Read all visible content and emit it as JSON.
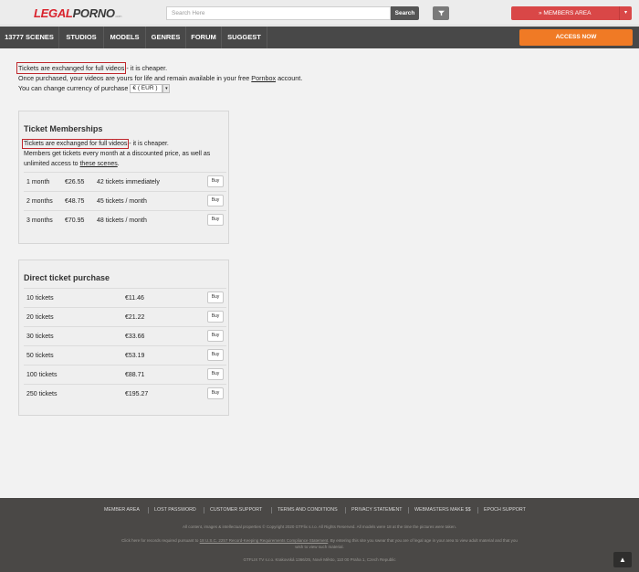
{
  "header": {
    "logo": {
      "part1": "LEGAL",
      "part2": "PORNO",
      "suffix": ".com"
    },
    "search_placeholder": "Search Here",
    "search_button": "Search",
    "filter_icon": "funnel-icon",
    "members_area": "» MEMBERS AREA",
    "members_caret": "▾"
  },
  "nav": {
    "items": [
      "13777 SCENES",
      "STUDIOS",
      "MODELS",
      "GENRES",
      "FORUM",
      "SUGGEST"
    ],
    "access_button": "ACCESS NOW"
  },
  "intro": {
    "highlight": "Tickets are exchanged for full videos",
    "rest": " - it is cheaper.",
    "line2_pre": "Once purchased, your videos are yours for life and remain available in your free ",
    "line2_link": "Pornbox",
    "line2_post": " account.",
    "line3": "You can change currency of purchase",
    "currency_value": "€ ( EUR )"
  },
  "memberships": {
    "title": "Ticket Memberships",
    "highlight": "Tickets are exchanged for full videos",
    "rest": " - it is cheaper.",
    "line2": "Members get tickets every month at a discounted price, as well as",
    "line3_pre": "unlimited access to ",
    "line3_link": "these scenes",
    "line3_post": ".",
    "plans": [
      {
        "period": "1 month",
        "price": "€26.55",
        "tickets": "42 tickets immediately",
        "buy": "Buy"
      },
      {
        "period": "2 months",
        "price": "€48.75",
        "tickets": "45 tickets / month",
        "buy": "Buy"
      },
      {
        "period": "3 months",
        "price": "€70.95",
        "tickets": "48 tickets / month",
        "buy": "Buy"
      }
    ]
  },
  "direct": {
    "title": "Direct ticket purchase",
    "items": [
      {
        "qty": "10 tickets",
        "price": "€11.46",
        "buy": "Buy"
      },
      {
        "qty": "20 tickets",
        "price": "€21.22",
        "buy": "Buy"
      },
      {
        "qty": "30 tickets",
        "price": "€33.66",
        "buy": "Buy"
      },
      {
        "qty": "50 tickets",
        "price": "€53.19",
        "buy": "Buy"
      },
      {
        "qty": "100 tickets",
        "price": "€88.71",
        "buy": "Buy"
      },
      {
        "qty": "250 tickets",
        "price": "€195.27",
        "buy": "Buy"
      }
    ]
  },
  "footer": {
    "links": [
      "MEMBER AREA",
      "LOST PASSWORD",
      "CUSTOMER SUPPORT",
      "TERMS AND CONDITIONS",
      "PRIVACY STATEMENT",
      "WEBMASTERS MAKE $$",
      "EPOCH SUPPORT"
    ],
    "copyright": "All content, images & intellectual properties © Copyright 2020 GTFlix s.r.o. All Rights Reserved. All models were 18 at the time the pictures were taken.",
    "compliance_pre": "Click here for records required pursuant to ",
    "compliance_link": "18 U.S.C. 2257 Record-Keeping Requirements Compliance Statement",
    "compliance_post": ". By entering this site you swear that you are of legal age in your area to view adult material and that you",
    "compliance_line2": "wish to view such material.",
    "address": "GTFLIX TV s.r.o. Krakovská 1366/25, Nové Město, 110 00 Praha 1, Czech Republic",
    "scroll_top": "▲"
  }
}
